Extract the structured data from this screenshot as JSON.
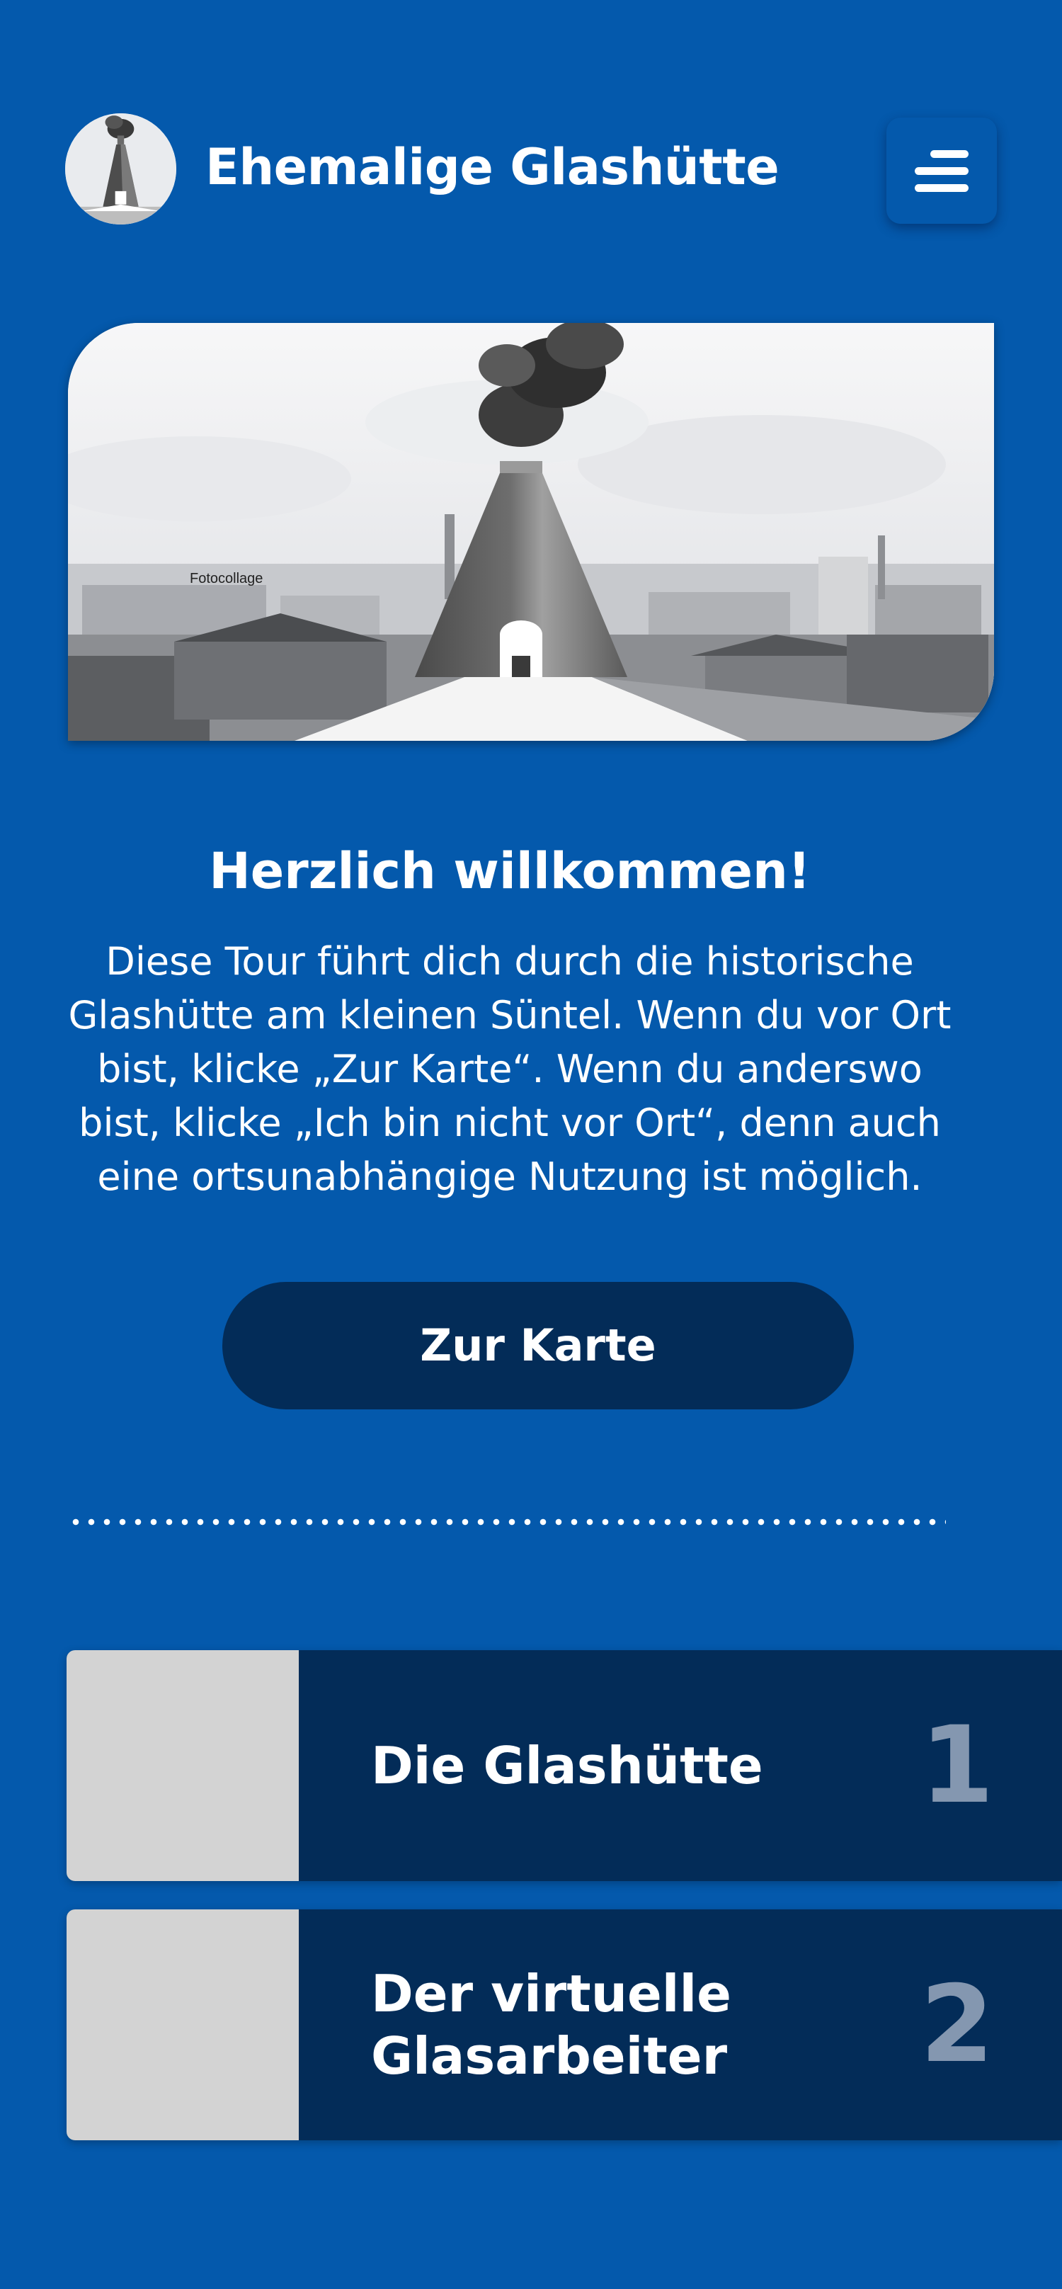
{
  "header": {
    "title": "Ehemalige Glashütte",
    "logo_icon": "glass-furnace-icon",
    "menu_icon": "menu-icon"
  },
  "hero": {
    "caption": "Fotocollage",
    "image": "glass-furnace-collage"
  },
  "welcome": {
    "title": "Herzlich willkommen!",
    "text": "Diese Tour führt dich durch die historische Glashütte am kleinen Süntel. Wenn du vor Ort bist, klicke „Zur Karte“. Wenn du anderswo bist, klicke „Ich bin nicht vor Ort“, denn auch eine ortsunabhängige Nutzung ist möglich.",
    "button_label": "Zur Karte"
  },
  "stations": [
    {
      "title": "Die Glashütte",
      "number": "1"
    },
    {
      "title": "Der virtuelle Glasarbeiter",
      "number": "2"
    }
  ],
  "colors": {
    "background": "#0459ac",
    "dark_navy": "#032c58",
    "number_gray": "#8497b0",
    "thumb_gray": "#d3d3d3"
  }
}
